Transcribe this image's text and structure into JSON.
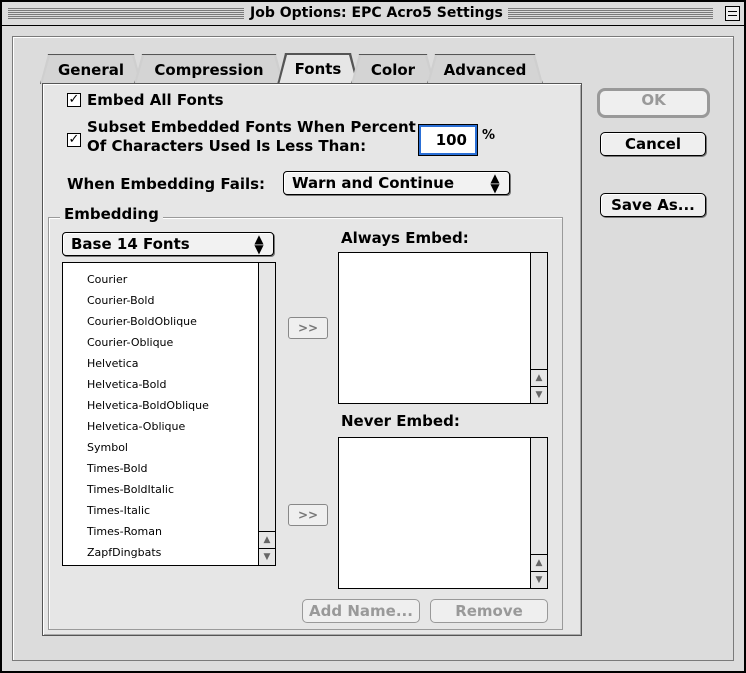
{
  "window": {
    "title": "Job Options: EPC Acro5 Settings"
  },
  "tabs": [
    {
      "label": "General",
      "active": false
    },
    {
      "label": "Compression",
      "active": false
    },
    {
      "label": "Fonts",
      "active": true
    },
    {
      "label": "Color",
      "active": false
    },
    {
      "label": "Advanced",
      "active": false
    }
  ],
  "fonts_panel": {
    "embed_all": {
      "label": "Embed All Fonts",
      "checked": true
    },
    "subset": {
      "label_line1": "Subset Embedded Fonts When Percent",
      "label_line2": "Of Characters Used Is Less Than:",
      "checked": true,
      "value": "100",
      "unit": "%"
    },
    "when_fails": {
      "label": "When Embedding Fails:",
      "selected": "Warn and Continue"
    },
    "embedding": {
      "group_label": "Embedding",
      "source_popup": "Base 14 Fonts",
      "font_list": [
        "Courier",
        "Courier-Bold",
        "Courier-BoldOblique",
        "Courier-Oblique",
        "Helvetica",
        "Helvetica-Bold",
        "Helvetica-BoldOblique",
        "Helvetica-Oblique",
        "Symbol",
        "Times-Bold",
        "Times-BoldItalic",
        "Times-Italic",
        "Times-Roman",
        "ZapfDingbats"
      ],
      "move_button": ">>",
      "always_embed_label": "Always Embed:",
      "never_embed_label": "Never Embed:",
      "add_name": "Add Name...",
      "remove": "Remove"
    }
  },
  "buttons": {
    "ok": "OK",
    "cancel": "Cancel",
    "save_as": "Save As..."
  },
  "colors": {
    "focus_ring": "#2a6fd6",
    "window_bg": "#dcdcdc",
    "panel_bg": "#e6e6e6"
  }
}
